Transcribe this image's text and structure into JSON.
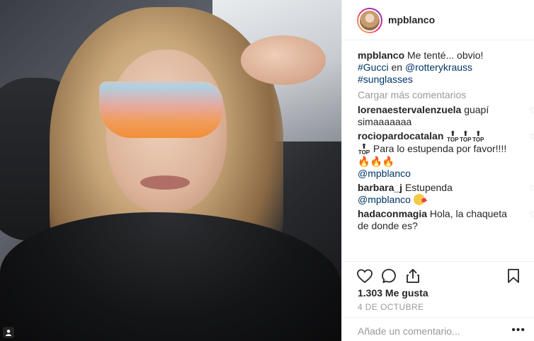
{
  "post": {
    "username": "mpblanco",
    "caption": {
      "user": "mpblanco",
      "text": "Me tenté... obvio!",
      "hashtag1": "#Gucci",
      "in_word": "en",
      "mention": "@rotterykrauss",
      "hashtag2": "#sunglasses"
    },
    "load_more": "Cargar más comentarios",
    "comments": [
      {
        "user": "lorenaestervalenzuela",
        "text": "guapí simaaaaaaa"
      },
      {
        "user": "rociopardocatalan",
        "badge_label": "TOP",
        "text": "Para lo estupenda por favor!!!!",
        "mention": "@mpblanco"
      },
      {
        "user": "barbara_j",
        "text": "Estupenda",
        "mention": "@mpblanco"
      },
      {
        "user": "hadaconmagia",
        "text": "Hola, la chaqueta de donde es?"
      }
    ],
    "likes": "1.303 Me gusta",
    "date": "4 DE OCTUBRE",
    "add_comment_placeholder": "Añade un comentario...",
    "more_glyph": "•••"
  },
  "icons": {
    "heart": "heart-icon",
    "comment": "comment-icon",
    "share": "share-icon",
    "bookmark": "bookmark-icon",
    "user_tag": "user-tag-icon"
  },
  "colors": {
    "link": "#003569",
    "muted": "#999999",
    "text": "#262626"
  }
}
